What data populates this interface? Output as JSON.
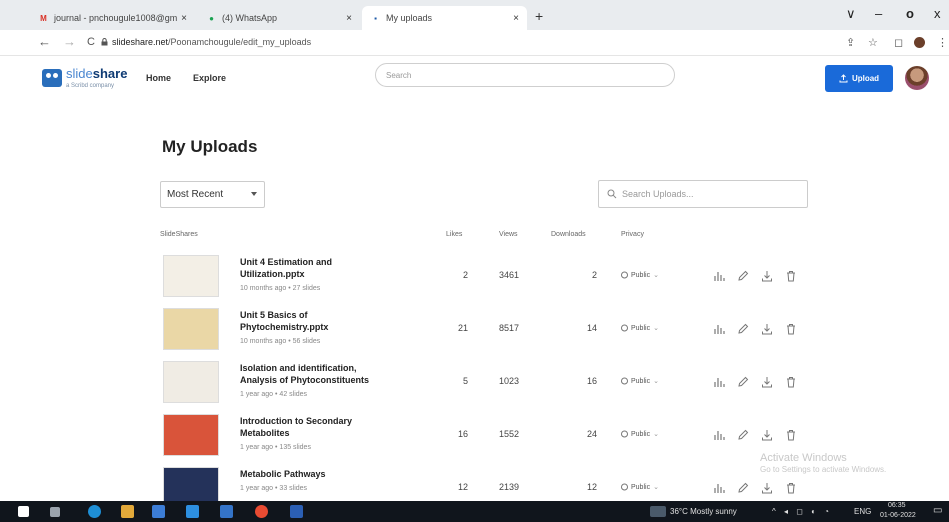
{
  "browser": {
    "tabs": [
      {
        "label": "journal - pnchougule1008@gm",
        "icon": "gmail-icon",
        "close": "×"
      },
      {
        "label": "(4) WhatsApp",
        "icon": "whatsapp-icon",
        "close": "×"
      },
      {
        "label": "My uploads",
        "icon": "slideshare-icon",
        "close": "×"
      }
    ],
    "new_tab": "+",
    "window_controls": {
      "dropdown": "∨",
      "minimize": "–",
      "maximize": "o",
      "close": "x"
    },
    "back": "←",
    "forward": "→",
    "reload": "C",
    "url_host": "slideshare.net",
    "url_path": "/Poonamchougule/edit_my_uploads"
  },
  "header": {
    "logo_word_a": "slide",
    "logo_word_b": "share",
    "logo_sub": "a Scribd company",
    "nav": [
      "Home",
      "Explore"
    ],
    "search_placeholder": "Search",
    "upload_label": "Upload"
  },
  "page": {
    "title": "My Uploads",
    "sort_value": "Most Recent",
    "search_placeholder": "Search Uploads..."
  },
  "table": {
    "headers": {
      "item": "SlideShares",
      "likes": "Likes",
      "views": "Views",
      "downloads": "Downloads",
      "privacy": "Privacy"
    },
    "rows": [
      {
        "title": "Unit 4 Estimation and Utilization.pptx",
        "meta": "10 months ago • 27 slides",
        "likes": "2",
        "views": "3461",
        "downloads": "2",
        "privacy": "Public",
        "thumb_color": "#f3efe6"
      },
      {
        "title": "Unit 5 Basics of Phytochemistry.pptx",
        "meta": "10 months ago • 56 slides",
        "likes": "21",
        "views": "8517",
        "downloads": "14",
        "privacy": "Public",
        "thumb_color": "#ead7a6"
      },
      {
        "title": "Isolation and identification, Analysis of Phytoconstituents",
        "meta": "1 year ago • 42 slides",
        "likes": "5",
        "views": "1023",
        "downloads": "16",
        "privacy": "Public",
        "thumb_color": "#f0ece4"
      },
      {
        "title": "Introduction to Secondary Metabolites",
        "meta": "1 year ago • 135 slides",
        "likes": "16",
        "views": "1552",
        "downloads": "24",
        "privacy": "Public",
        "thumb_color": "#d9543a"
      },
      {
        "title": "Metabolic Pathways",
        "meta": "1 year ago • 33 slides",
        "likes": "12",
        "views": "2139",
        "downloads": "12",
        "privacy": "Public",
        "thumb_color": "#24325a"
      }
    ]
  },
  "watermark": {
    "line1": "Activate Windows",
    "line2": "Go to Settings to activate Windows."
  },
  "taskbar": {
    "weather": "36°C  Mostly sunny",
    "lang": "ENG",
    "time": "06:35",
    "date": "01-06-2022"
  },
  "colors": {
    "accent": "#1a6ad9",
    "brand": "#1e5aa8",
    "taskbar": "#10151c"
  }
}
